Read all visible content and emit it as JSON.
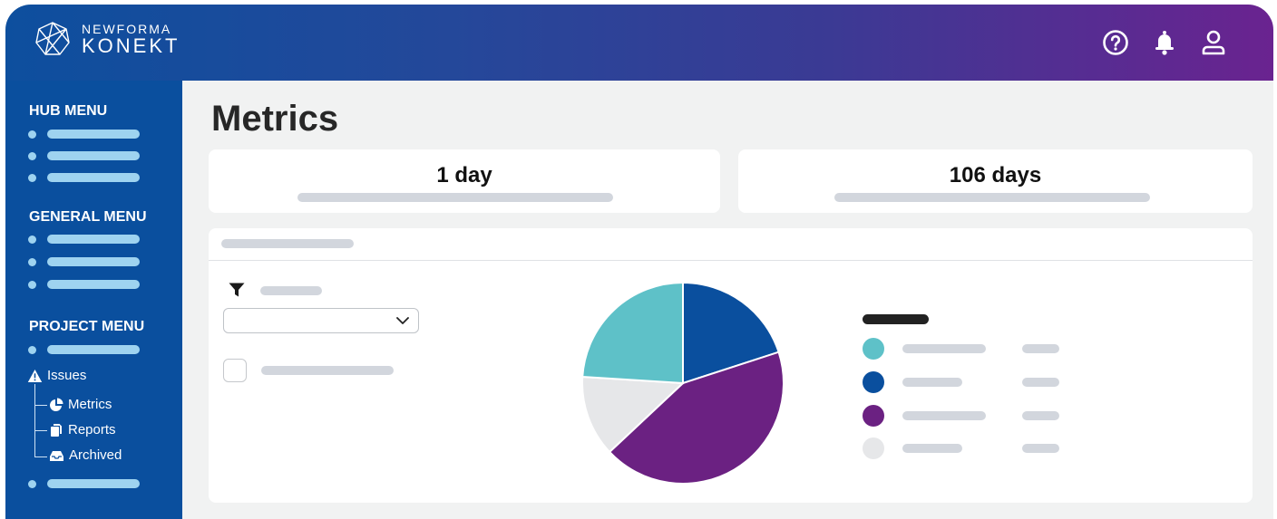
{
  "brand": {
    "line1": "NEWFORMA",
    "line2": "KONEKT"
  },
  "header_icons": [
    "help-circle-icon",
    "bell-icon",
    "user-icon"
  ],
  "sidebar": {
    "hub_menu_title": "HUB MENU",
    "general_menu_title": "GENERAL MENU",
    "project_menu_title": "PROJECT MENU",
    "issues_label": "Issues",
    "sub_items": [
      {
        "label": "Metrics",
        "icon": "pie-chart-icon"
      },
      {
        "label": "Reports",
        "icon": "documents-icon"
      },
      {
        "label": "Archived",
        "icon": "archive-tray-icon"
      }
    ]
  },
  "main": {
    "title": "Metrics",
    "stats": [
      {
        "value": "1 day"
      },
      {
        "value": "106 days"
      }
    ]
  },
  "chart_data": {
    "type": "pie",
    "slices": [
      {
        "value": 20,
        "color": "#0a4f9e"
      },
      {
        "value": 43,
        "color": "#6b2182"
      },
      {
        "value": 13,
        "color": "#e6e7e9"
      },
      {
        "value": 24,
        "color": "#5ec1c8"
      }
    ],
    "legend_colors": [
      "#5ec1c8",
      "#0a4f9e",
      "#6b2182",
      "#e6e7e9"
    ]
  },
  "colors": {
    "sidebar": "#0a4f9e",
    "placeholder_light_blue": "#9ed3f0",
    "placeholder_gray": "#d2d6dd",
    "page_background": "#f1f2f2"
  }
}
